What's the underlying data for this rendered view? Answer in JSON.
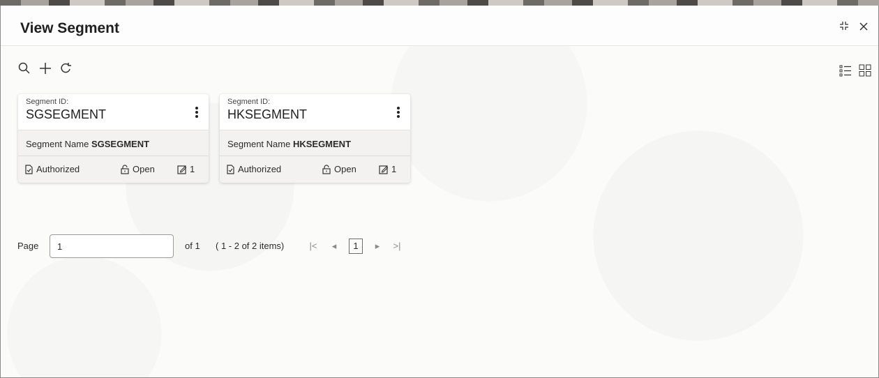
{
  "window": {
    "title": "View Segment",
    "minimize_icon": "collapse-icon",
    "close_icon": "close-icon"
  },
  "toolbar": {
    "search_icon": "search-icon",
    "add_icon": "plus-icon",
    "refresh_icon": "refresh-icon",
    "list_view_icon": "list-view-icon",
    "tile_view_icon": "tile-view-icon"
  },
  "cards": [
    {
      "id_label": "Segment ID:",
      "id": "SGSEGMENT",
      "name_label": "Segment Name",
      "name": "SGSEGMENT",
      "status": "Authorized",
      "lock": "Open",
      "edit_count": "1"
    },
    {
      "id_label": "Segment ID:",
      "id": "HKSEGMENT",
      "name_label": "Segment Name",
      "name": "HKSEGMENT",
      "status": "Authorized",
      "lock": "Open",
      "edit_count": "1"
    }
  ],
  "pagination": {
    "page_label": "Page",
    "page_value": "1",
    "of_text": "of 1",
    "items_text": "( 1 - 2 of 2 items)",
    "first": "|<",
    "prev": "◂",
    "current": "1",
    "next": "▸",
    "last": ">|"
  },
  "colors": {
    "card_bg": "#f3f2f1",
    "card_head_bg": "#ffffff",
    "text": "#2b2b2b"
  }
}
